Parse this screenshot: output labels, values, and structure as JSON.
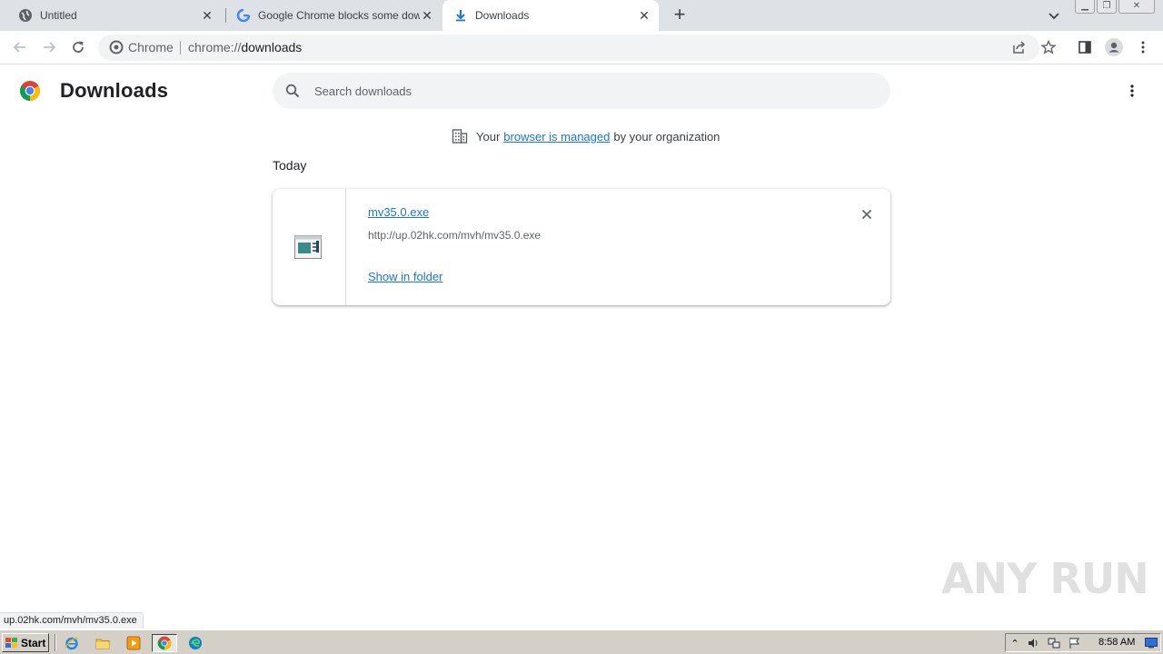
{
  "tabs": [
    {
      "title": "Untitled",
      "favicon": "globe-icon"
    },
    {
      "title": "Google Chrome blocks some downloa",
      "favicon": "google-g-icon"
    },
    {
      "title": "Downloads",
      "favicon": "download-icon",
      "active": true
    }
  ],
  "omnibox": {
    "chip": "Chrome",
    "url_scheme": "chrome://",
    "url_host": "downloads"
  },
  "page": {
    "title": "Downloads",
    "search_placeholder": "Search downloads"
  },
  "managed": {
    "prefix": "Your",
    "link": "browser is managed",
    "suffix": "by your organization"
  },
  "date_group": "Today",
  "download": {
    "file_name": "mv35.0.exe",
    "url": "http://up.02hk.com/mvh/mv35.0.exe",
    "action": "Show in folder"
  },
  "status_bar": "up.02hk.com/mvh/mv35.0.exe",
  "watermark": "ANY RUN",
  "taskbar": {
    "start_label": "Start",
    "clock": "8:58 AM"
  },
  "colors": {
    "accent": "#1a73e8",
    "tabstrip": "#dee1e6",
    "taskbar": "#d4d0c8"
  }
}
